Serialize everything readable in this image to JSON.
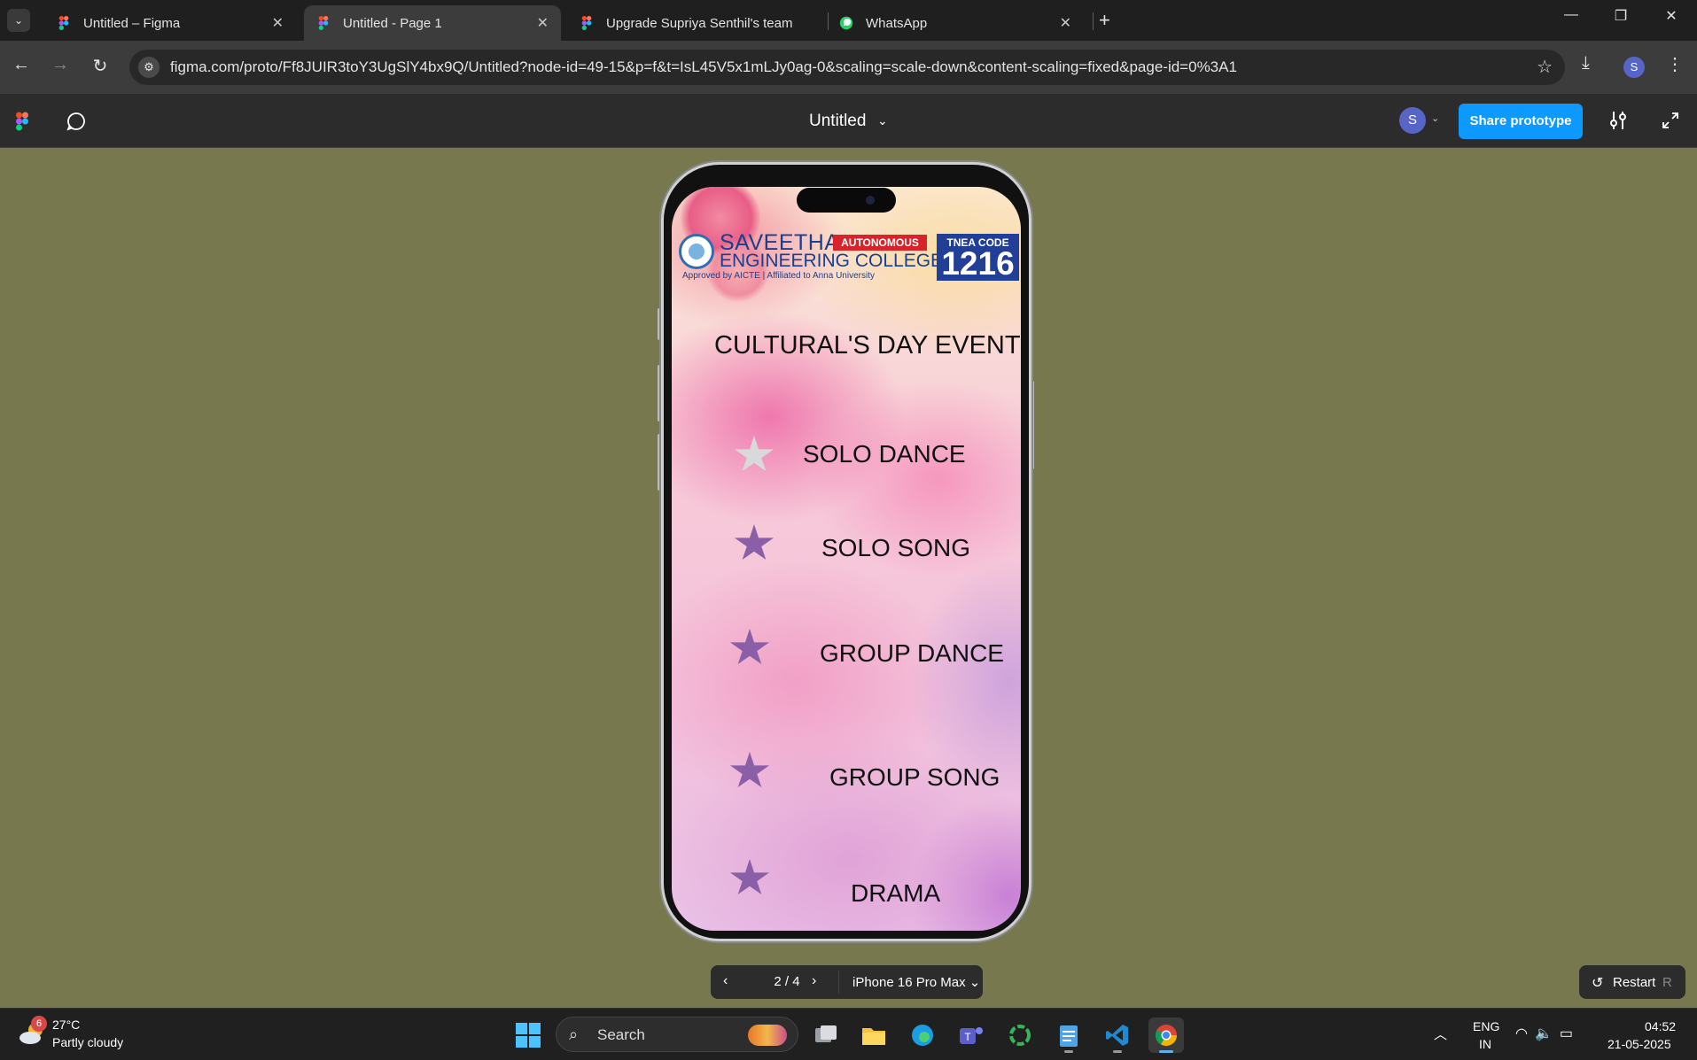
{
  "browser": {
    "tabs": [
      {
        "title": "Untitled – Figma",
        "active": false,
        "favicon": "figma-icon"
      },
      {
        "title": "Untitled - Page 1",
        "active": true,
        "favicon": "figma-icon"
      },
      {
        "title": "Upgrade Supriya Senthil's team",
        "active": false,
        "favicon": "figma-icon"
      },
      {
        "title": "WhatsApp",
        "active": false,
        "favicon": "whatsapp-icon"
      }
    ],
    "new_tab_label": "+",
    "url": "figma.com/proto/Ff8JUIR3toY3UgSlY4bx9Q/Untitled?node-id=49-15&p=f&t=IsL45V5x1mLJy0ag-0&scaling=scale-down&content-scaling=fixed&page-id=0%3A1",
    "profile_initial": "S"
  },
  "figma": {
    "doc_title": "Untitled",
    "user_initial": "S",
    "share_label": "Share prototype",
    "accent": "#0d99ff"
  },
  "screen": {
    "logo": {
      "name_line1": "SAVEETHA",
      "badge": "AUTONOMOUS",
      "name_line2": "ENGINEERING COLLEGE",
      "subline": "Approved by AICTE | Affiliated to Anna University",
      "tnea_label": "TNEA CODE",
      "tnea_code": "1216"
    },
    "title": "CULTURAL'S DAY EVENT",
    "events": [
      {
        "label": "SOLO DANCE",
        "star_color": "#d9d9d9"
      },
      {
        "label": "SOLO SONG",
        "star_color": "#8a5fa8"
      },
      {
        "label": "GROUP DANCE",
        "star_color": "#8a5fa8"
      },
      {
        "label": "GROUP SONG",
        "star_color": "#8a5fa8"
      },
      {
        "label": "DRAMA",
        "star_color": "#8a5fa8"
      }
    ]
  },
  "prototype_controls": {
    "page_counter": "2 / 4",
    "device": "iPhone 16 Pro Max",
    "restart_label": "Restart",
    "restart_key": "R"
  },
  "taskbar": {
    "weather_temp": "27°C",
    "weather_desc": "Partly cloudy",
    "weather_badge": "6",
    "search_label": "Search",
    "lang_line1": "ENG",
    "lang_line2": "IN",
    "time": "04:52",
    "date": "21-05-2025"
  }
}
